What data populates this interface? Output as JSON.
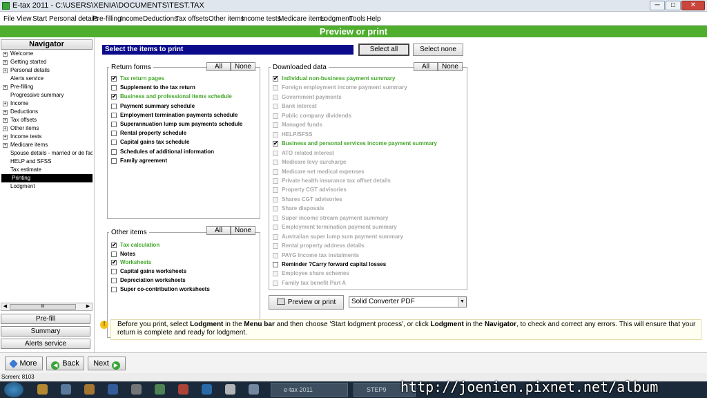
{
  "window": {
    "title": "E-tax 2011 - C:\\USERS\\XENIA\\DOCUMENTS\\TEST.TAX",
    "minimize": "─",
    "maximize": "□",
    "close": "✕"
  },
  "menu": [
    "File",
    "View",
    "Start",
    "Personal details",
    "Pre-filling",
    "Income",
    "Deductions",
    "Tax offsets",
    "Other items",
    "Income tests",
    "Medicare items",
    "Lodgment",
    "Tools",
    "Help"
  ],
  "page_title": "Preview or print",
  "navigator": {
    "title": "Navigator",
    "items": [
      {
        "label": "Welcome",
        "expand": "+"
      },
      {
        "label": "Getting started",
        "expand": "+"
      },
      {
        "label": "Personal details",
        "expand": "+"
      },
      {
        "label": "Alerts service",
        "expand": ""
      },
      {
        "label": "Pre-filling",
        "expand": "+"
      },
      {
        "label": "Progressive summary",
        "expand": ""
      },
      {
        "label": "Income",
        "expand": "+"
      },
      {
        "label": "Deductions",
        "expand": "+"
      },
      {
        "label": "Tax offsets",
        "expand": "+"
      },
      {
        "label": "Other items",
        "expand": "+"
      },
      {
        "label": "Income tests",
        "expand": "+"
      },
      {
        "label": "Medicare items",
        "expand": "+"
      },
      {
        "label": "Spouse details - married or de facto",
        "expand": ""
      },
      {
        "label": "HELP and SFSS",
        "expand": ""
      },
      {
        "label": "Tax estimate",
        "expand": ""
      },
      {
        "label": "Printing",
        "expand": "",
        "selected": true
      },
      {
        "label": "Lodgment",
        "expand": ""
      }
    ],
    "scroll_left": "◀",
    "scroll_right": "▶",
    "scroll_thumb": "III",
    "buttons": [
      "Pre-fill",
      "Summary",
      "Alerts service"
    ]
  },
  "select_header": "Select the items to print",
  "select_all": "Select all",
  "select_none": "Select none",
  "all_label": "All",
  "none_label": "None",
  "return_forms": {
    "title": "Return forms",
    "items": [
      {
        "label": "Tax return pages",
        "checked": true,
        "style": "green"
      },
      {
        "label": "Supplement to the tax return",
        "checked": false,
        "style": "normal"
      },
      {
        "label": "Business and professional items schedule",
        "checked": true,
        "style": "green"
      },
      {
        "label": "Payment summary schedule",
        "checked": false,
        "style": "normal"
      },
      {
        "label": "Employment termination payments schedule",
        "checked": false,
        "style": "normal"
      },
      {
        "label": "Superannuation lump sum payments schedule",
        "checked": false,
        "style": "normal"
      },
      {
        "label": "Rental property schedule",
        "checked": false,
        "style": "normal"
      },
      {
        "label": "Capital gains tax schedule",
        "checked": false,
        "style": "normal"
      },
      {
        "label": "Schedules of additional information",
        "checked": false,
        "style": "normal"
      },
      {
        "label": "Family agreement",
        "checked": false,
        "style": "normal"
      }
    ]
  },
  "other_items": {
    "title": "Other items",
    "items": [
      {
        "label": "Tax calculation",
        "checked": true,
        "style": "green"
      },
      {
        "label": "Notes",
        "checked": false,
        "style": "normal"
      },
      {
        "label": "Worksheets",
        "checked": true,
        "style": "green"
      },
      {
        "label": "Capital gains worksheets",
        "checked": false,
        "style": "normal"
      },
      {
        "label": "Depreciation worksheets",
        "checked": false,
        "style": "normal"
      },
      {
        "label": "Super co-contribution worksheets",
        "checked": false,
        "style": "normal"
      }
    ]
  },
  "downloaded_data": {
    "title": "Downloaded data",
    "items": [
      {
        "label": "Individual non-business payment summary",
        "checked": true,
        "style": "green"
      },
      {
        "label": "Foreign employment income payment summary",
        "checked": false,
        "style": "gray"
      },
      {
        "label": "Government payments",
        "checked": false,
        "style": "gray"
      },
      {
        "label": "Bank interest",
        "checked": false,
        "style": "gray"
      },
      {
        "label": "Public company dividends",
        "checked": false,
        "style": "gray"
      },
      {
        "label": "Managed funds",
        "checked": false,
        "style": "gray"
      },
      {
        "label": "HELP/SFSS",
        "checked": false,
        "style": "gray"
      },
      {
        "label": "Business and personal services income payment summary",
        "checked": true,
        "style": "green"
      },
      {
        "label": "ATO related interest",
        "checked": false,
        "style": "gray"
      },
      {
        "label": "Medicare levy surcharge",
        "checked": false,
        "style": "gray"
      },
      {
        "label": "Medicare net medical expenses",
        "checked": false,
        "style": "gray"
      },
      {
        "label": "Private health insurance tax offset details",
        "checked": false,
        "style": "gray"
      },
      {
        "label": "Property CGT advisories",
        "checked": false,
        "style": "gray"
      },
      {
        "label": "Shares CGT advisories",
        "checked": false,
        "style": "gray"
      },
      {
        "label": "Share disposals",
        "checked": false,
        "style": "gray"
      },
      {
        "label": "Super income stream payment summary",
        "checked": false,
        "style": "gray"
      },
      {
        "label": "Employment termination payment summary",
        "checked": false,
        "style": "gray"
      },
      {
        "label": "Australian super lump sum payment summary",
        "checked": false,
        "style": "gray"
      },
      {
        "label": "Rental property address details",
        "checked": false,
        "style": "gray"
      },
      {
        "label": "PAYG Income tax instalments",
        "checked": false,
        "style": "gray"
      },
      {
        "label": "Reminder ?Carry forward capital losses",
        "checked": false,
        "style": "normal"
      },
      {
        "label": "Employee share schemes",
        "checked": false,
        "style": "gray"
      },
      {
        "label": "Family tax benefit Part A",
        "checked": false,
        "style": "gray"
      }
    ]
  },
  "preview_button": "Preview or print",
  "printer": {
    "selected": "Solid Converter PDF",
    "arrow": "▼"
  },
  "info": {
    "icon": "!",
    "t1": "Before you print, select ",
    "b1": "Lodgment",
    "t2": " in the ",
    "b2": "Menu bar",
    "t3": " and then choose 'Start lodgment process', or click ",
    "b3": "Lodgment",
    "t4": " in the ",
    "b4": "Navigator",
    "t5": ", to check and correct any errors. This will ensure that your return is complete and ready for lodgment."
  },
  "bottom_buttons": {
    "more": "More",
    "back": "Back",
    "next": "Next"
  },
  "status": "Screen: 8103",
  "taskbar": {
    "item1": "e-tax 2011",
    "item2": "STEP9"
  },
  "watermark": "http://joenien.pixnet.net/album",
  "colors": {
    "accent_green": "#4fae2e",
    "header_blue": "#0b0b8c",
    "checked_green": "#44a82a",
    "disabled_gray": "#a8a8a8"
  }
}
